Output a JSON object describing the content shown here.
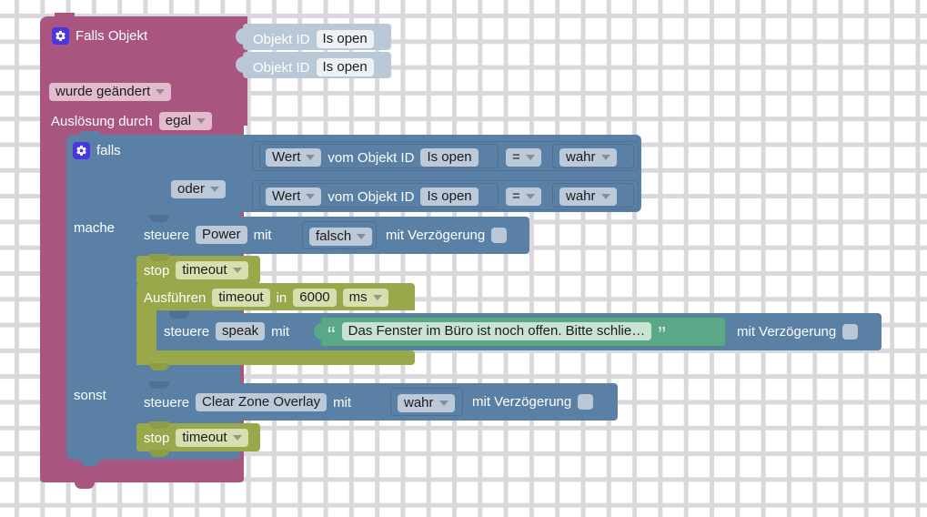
{
  "app": {
    "type": "blockly-visual-programming-editor",
    "language": "de"
  },
  "colors": {
    "trigger_block": "#a8557f",
    "trigger_block_alt": "#b0628c",
    "logic_block": "#5b80a5",
    "value_block": "#b9c8d6",
    "timer_block": "#9aa84c",
    "string_block": "#5aa888",
    "gear_icon": "#4b35e0",
    "background": "#ffffff",
    "grid_dot": "#d8d8dd"
  },
  "trigger": {
    "icon": "gear-icon",
    "title": "Falls Objekt",
    "objects": [
      {
        "label": "Objekt ID",
        "value": "Is open"
      },
      {
        "label": "Objekt ID",
        "value": "Is open"
      }
    ],
    "change_dropdown": "wurde geändert",
    "source_label": "Auslösung durch",
    "source_dropdown": "egal"
  },
  "conditional": {
    "icon": "gear-icon",
    "if_label": "falls",
    "operator_dropdown": "oder",
    "do_label": "mache",
    "else_label": "sonst",
    "conditions": [
      {
        "mode": "Wert",
        "of_label": "vom Objekt ID",
        "object": "Is open",
        "comparator": "=",
        "compare_to": "wahr"
      },
      {
        "mode": "Wert",
        "of_label": "vom Objekt ID",
        "object": "Is open",
        "comparator": "=",
        "compare_to": "wahr"
      }
    ]
  },
  "do_statements": [
    {
      "kind": "control",
      "verb": "steuere",
      "target": "Power",
      "with_label": "mit",
      "value": "falsch",
      "delay_label": "mit Verzögerung",
      "delay_checked": false
    },
    {
      "kind": "timer-stop",
      "verb": "stop",
      "timer": "timeout"
    },
    {
      "kind": "timer-run",
      "verb": "Ausführen",
      "timer": "timeout",
      "in_label": "in",
      "duration": "6000",
      "unit": "ms",
      "nested": {
        "kind": "control",
        "verb": "steuere",
        "target": "speak",
        "with_label": "mit",
        "quote_open": "“",
        "quote_close": "”",
        "text": "Das Fenster im Büro ist noch offen. Bitte schlie…",
        "delay_label": "mit Verzögerung",
        "delay_checked": false
      }
    }
  ],
  "else_statements": [
    {
      "kind": "control",
      "verb": "steuere",
      "target": "Clear Zone Overlay",
      "with_label": "mit",
      "value": "wahr",
      "delay_label": "mit Verzögerung",
      "delay_checked": false
    },
    {
      "kind": "timer-stop",
      "verb": "stop",
      "timer": "timeout"
    }
  ]
}
